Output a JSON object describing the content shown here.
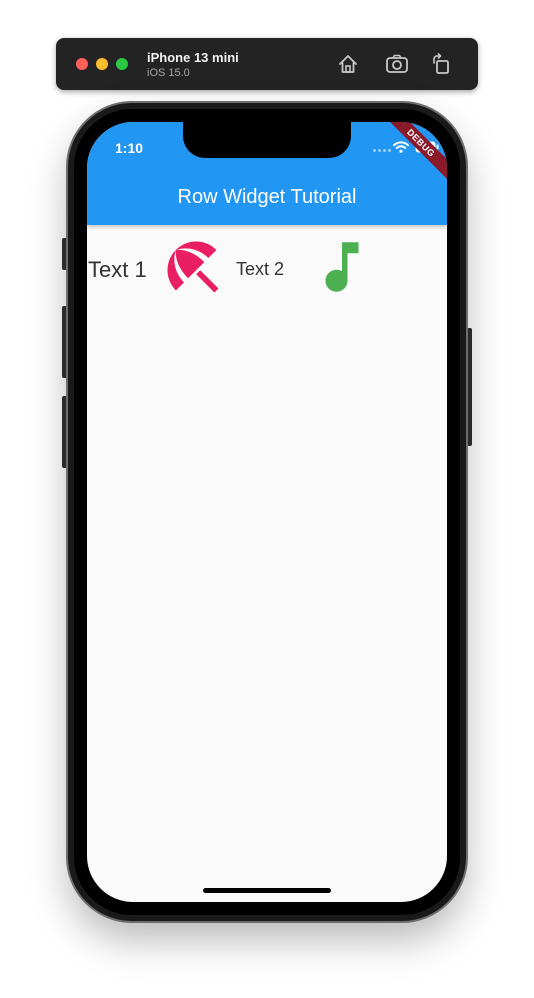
{
  "simulator": {
    "device_name": "iPhone 13 mini",
    "os_version": "iOS 15.0",
    "buttons": {
      "home": "home-icon",
      "screenshot": "camera-icon",
      "rotate": "rotate-icon"
    }
  },
  "status_bar": {
    "time": "1:10"
  },
  "app_bar": {
    "title": "Row Widget Tutorial",
    "color": "#2196f3",
    "debug_label": "DEBUG"
  },
  "row": {
    "items": [
      {
        "type": "text",
        "label": "Text 1"
      },
      {
        "type": "icon",
        "name": "beach-umbrella-icon",
        "color": "#e91e63"
      },
      {
        "type": "text",
        "label": "Text 2"
      },
      {
        "type": "icon",
        "name": "music-note-icon",
        "color": "#4caf50"
      }
    ]
  }
}
